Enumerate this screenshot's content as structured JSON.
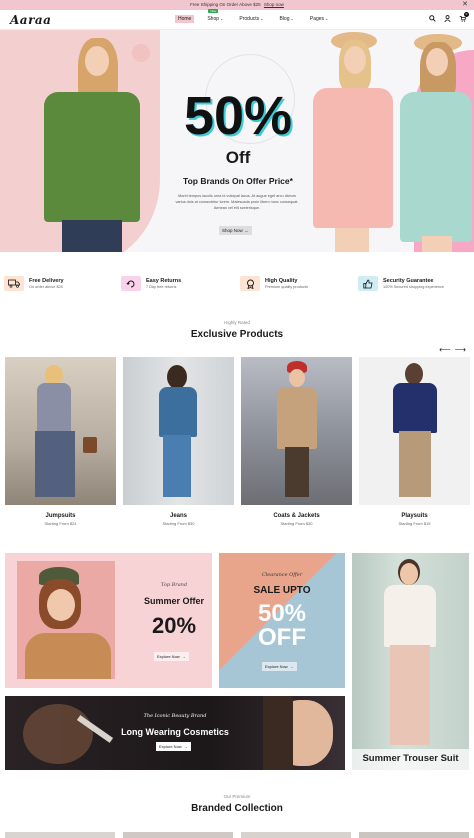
{
  "topbar": {
    "text": "Free Shipping On Order Above $25",
    "link": "Shop now",
    "close": "✕"
  },
  "header": {
    "logo": "Aaraa",
    "nav": [
      {
        "label": "Home",
        "caret": "",
        "badge": ""
      },
      {
        "label": "Shop",
        "caret": "⌄",
        "badge": "New"
      },
      {
        "label": "Products",
        "caret": "⌄",
        "badge": ""
      },
      {
        "label": "Blog",
        "caret": "⌄",
        "badge": ""
      },
      {
        "label": "Pages",
        "caret": "⌄",
        "badge": ""
      }
    ],
    "cart_count": "0"
  },
  "hero": {
    "percent": "50%",
    "off": "Off",
    "subtitle": "Top Brands On Offer Price*",
    "desc": "Morbi tempus iaculis urna id volutpat lacus. At augue eget arcu dictum varius duis at consectetur lorem. Malesuada proin libero nunc consequat. Aenean vel elit scelerisque.",
    "button": "Shop Now",
    "slide_active": 1,
    "slide_count": 3
  },
  "features": [
    {
      "title": "Free Delivery",
      "sub": "On order above $25",
      "icon": "truck-icon",
      "color": "#fde3d3"
    },
    {
      "title": "Easy Returns",
      "sub": "7 Day free returns",
      "icon": "return-icon",
      "color": "#f8d3ea"
    },
    {
      "title": "High Quality",
      "sub": "Premium quality products",
      "icon": "badge-icon",
      "color": "#fde3d3"
    },
    {
      "title": "Security Guarantee",
      "sub": "100% Secured shopping experience",
      "icon": "thumb-icon",
      "color": "#cfeef3"
    }
  ],
  "exclusive": {
    "kicker": "Highly Rated",
    "title": "Exclusive Products",
    "items": [
      {
        "name": "Jumpsuits",
        "price": "Starting From $24"
      },
      {
        "name": "Jeans",
        "price": "Starting From $30"
      },
      {
        "name": "Coats & Jackets",
        "price": "Starting From $30"
      },
      {
        "name": "Playsuits",
        "price": "Starting From $15"
      }
    ]
  },
  "banners": {
    "summer": {
      "kicker": "Top Brand",
      "title": "Summer Offer",
      "value": "20%",
      "button": "Explore Now"
    },
    "sale": {
      "kicker": "Clearance Offer",
      "title": "SALE UPTO",
      "value": "50%",
      "off": "OFF",
      "button": "Explore Now"
    },
    "cosmetics": {
      "kicker": "The Iconic Beauty Brand",
      "title": "Long Wearing Cosmetics",
      "button": "Explore Now"
    },
    "trouser": {
      "title": "Summer Trouser Suit"
    }
  },
  "branded": {
    "kicker": "Our Premium",
    "title": "Branded Collection"
  }
}
